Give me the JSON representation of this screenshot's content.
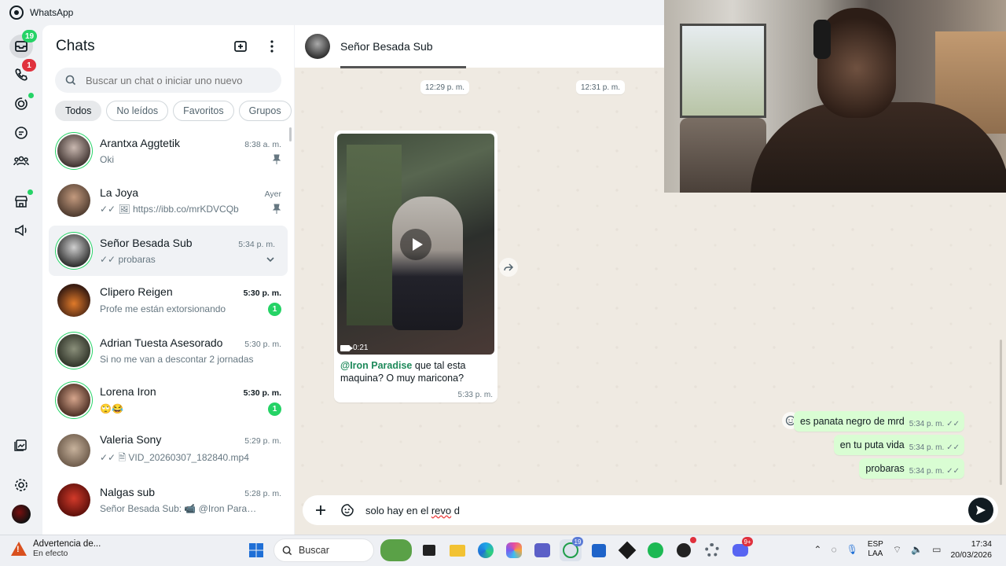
{
  "app": {
    "title": "WhatsApp"
  },
  "rail": {
    "chats_badge": "19",
    "calls_badge": "1"
  },
  "panel": {
    "title": "Chats",
    "search_placeholder": "Buscar un chat o iniciar uno nuevo",
    "filters": [
      "Todos",
      "No leídos",
      "Favoritos",
      "Grupos"
    ]
  },
  "chats": [
    {
      "name": "Arantxa Aggtetik",
      "time": "8:38 a. m.",
      "preview": "Oki",
      "pinned": true,
      "ring": true
    },
    {
      "name": "La Joya",
      "time": "Ayer",
      "preview": "✓✓ 🖼 https://ibb.co/mrKDVCQb",
      "pinned": true,
      "ring": false
    },
    {
      "name": "Señor Besada Sub",
      "time": "5:34 p. m.",
      "preview": "✓✓ probaras",
      "selected": true,
      "ring": true
    },
    {
      "name": "Clipero Reigen",
      "time": "5:30 p. m.",
      "preview": "Profe me están extorsionando",
      "unread": "1",
      "bold_time": true
    },
    {
      "name": "Adrian Tuesta Asesorado",
      "time": "5:30 p. m.",
      "preview": "Si no me van a descontar 2 jornadas",
      "ring": true
    },
    {
      "name": "Lorena Iron",
      "time": "5:30 p. m.",
      "preview": "🙄😂",
      "unread": "1",
      "bold_time": true,
      "ring": true
    },
    {
      "name": "Valeria Sony",
      "time": "5:29 p. m.",
      "preview": "✓✓ 🗎 VID_20260307_182840.mp4"
    },
    {
      "name": "Nalgas sub",
      "time": "5:28 p. m.",
      "preview": "Señor Besada Sub: 📹 @Iron Paradise ..."
    }
  ],
  "conversation": {
    "contact_name": "Señor Besada Sub",
    "pills": [
      "12:29 p. m.",
      "12:31 p. m."
    ],
    "video_message": {
      "duration": "0:21",
      "mention": "@Iron Paradise",
      "caption": " que tal esta maquina? O muy maricona?",
      "time": "5:33 p. m."
    },
    "outgoing": [
      {
        "text": "es panata negro de mrd",
        "time": "5:34 p. m."
      },
      {
        "text": "en tu puta vida",
        "time": "5:34 p. m."
      },
      {
        "text": "probaras",
        "time": "5:34 p. m."
      }
    ],
    "composer_text_a": "solo hay en el ",
    "composer_text_typo": "revo",
    "composer_text_b": " d"
  },
  "taskbar": {
    "alert_title": "Advertencia de...",
    "alert_sub": "En efecto",
    "search_label": "Buscar",
    "whatsapp_badge": "19",
    "discord_badge": "9+",
    "lang_line1": "ESP",
    "lang_line2": "LAA",
    "time": "17:34",
    "date": "20/03/2026"
  },
  "colors": {
    "accent": "#25d366",
    "outgoing_bubble": "#d9fdd3",
    "chat_background": "#efeae2",
    "badge_red": "#e0313d"
  }
}
